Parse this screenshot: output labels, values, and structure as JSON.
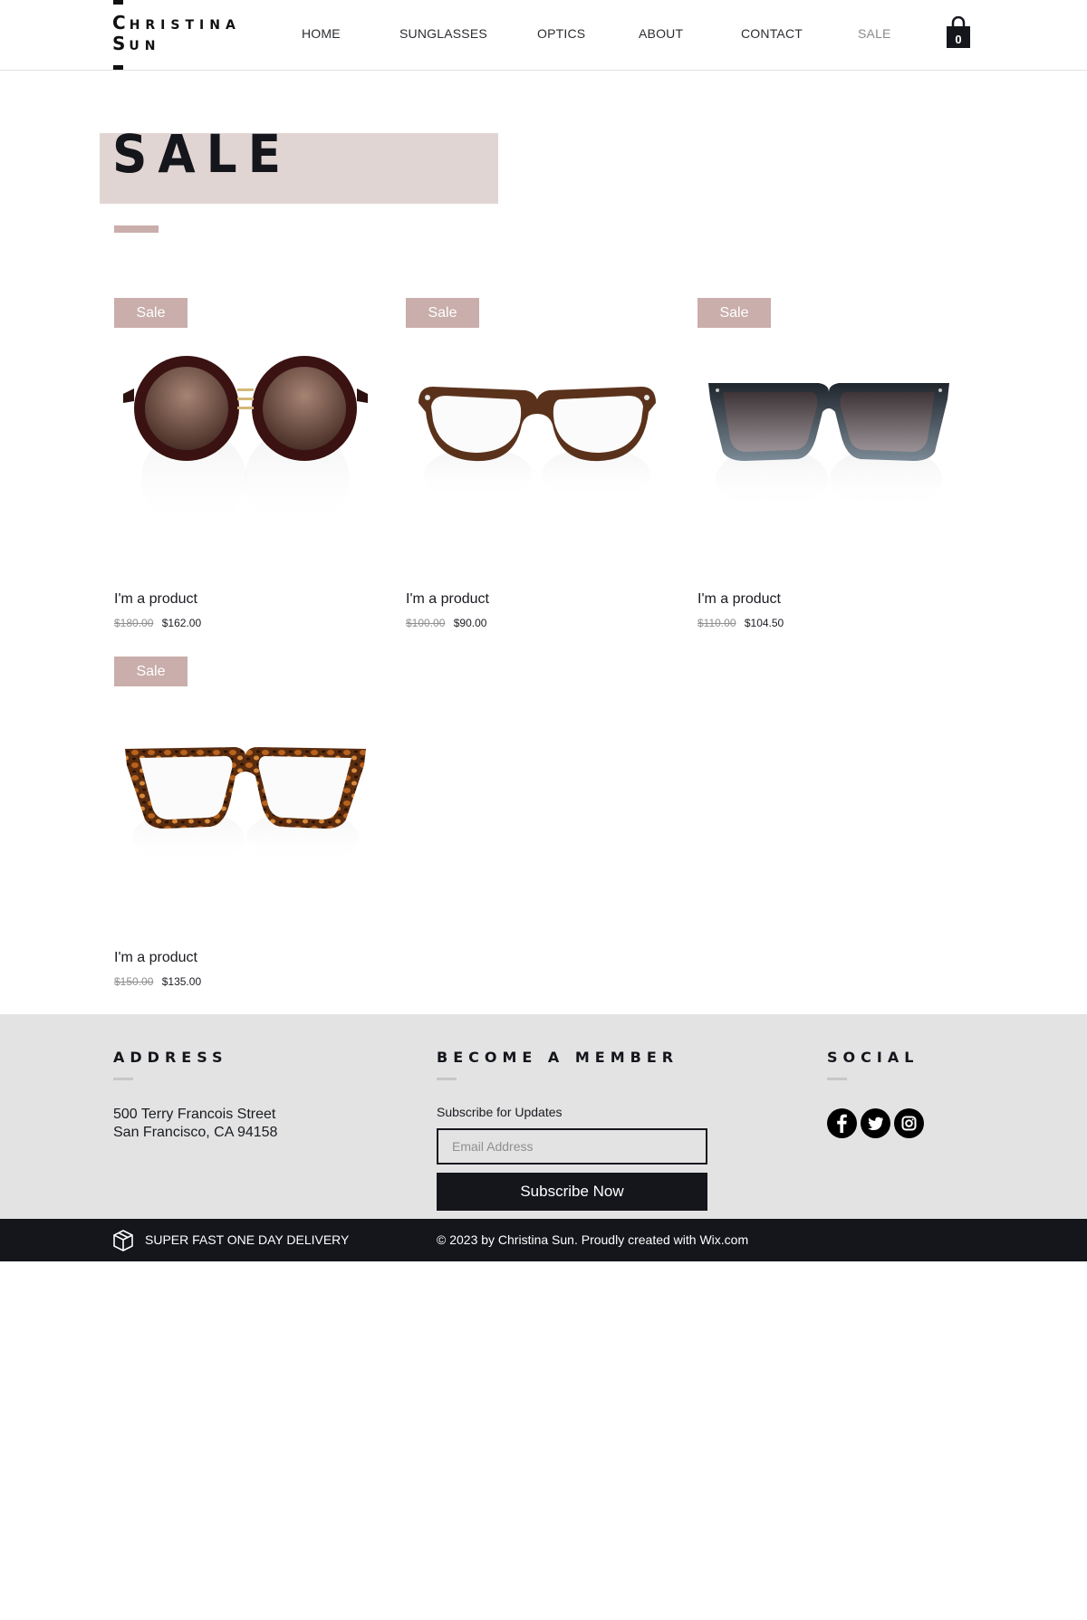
{
  "header": {
    "logo": {
      "line1_initial": "C",
      "line1_rest": "HRISTINA",
      "line2_initial": "S",
      "line2_rest": "UN"
    },
    "nav": [
      "HOME",
      "SUNGLASSES",
      "OPTICS",
      "ABOUT",
      "CONTACT",
      "SALE"
    ],
    "active_nav": "SALE",
    "cart_count": "0"
  },
  "page": {
    "title": "SALE"
  },
  "products": [
    {
      "badge": "Sale",
      "name": "I'm a product",
      "old_price": "$180.00",
      "new_price": "$162.00",
      "image": "round-brown-sunglasses"
    },
    {
      "badge": "Sale",
      "name": "I'm a product",
      "old_price": "$100.00",
      "new_price": "$90.00",
      "image": "brown-clear-eyeglasses"
    },
    {
      "badge": "Sale",
      "name": "I'm a product",
      "old_price": "$110.00",
      "new_price": "$104.50",
      "image": "black-square-sunglasses"
    },
    {
      "badge": "Sale",
      "name": "I'm a product",
      "old_price": "$150.00",
      "new_price": "$135.00",
      "image": "tortoise-clear-eyeglasses"
    }
  ],
  "footer": {
    "address": {
      "heading": "ADDRESS",
      "line1": "500 Terry Francois Street",
      "line2": "San Francisco, CA 94158"
    },
    "member": {
      "heading": "BECOME A MEMBER",
      "label": "Subscribe for Updates",
      "email_placeholder": "Email Address",
      "button": "Subscribe Now"
    },
    "social": {
      "heading": "SOCIAL",
      "icons": [
        "facebook-icon",
        "twitter-icon",
        "instagram-icon"
      ]
    }
  },
  "bottom_bar": {
    "delivery": "SUPER FAST ONE DAY DELIVERY",
    "copyright": "© 2023 by Christina Sun. Proudly created with Wix.com"
  },
  "colors": {
    "accent_pink": "#c9aeab",
    "title_block": "#e1d5d3",
    "dark": "#14161c",
    "footer_bg": "#e3e3e3"
  }
}
